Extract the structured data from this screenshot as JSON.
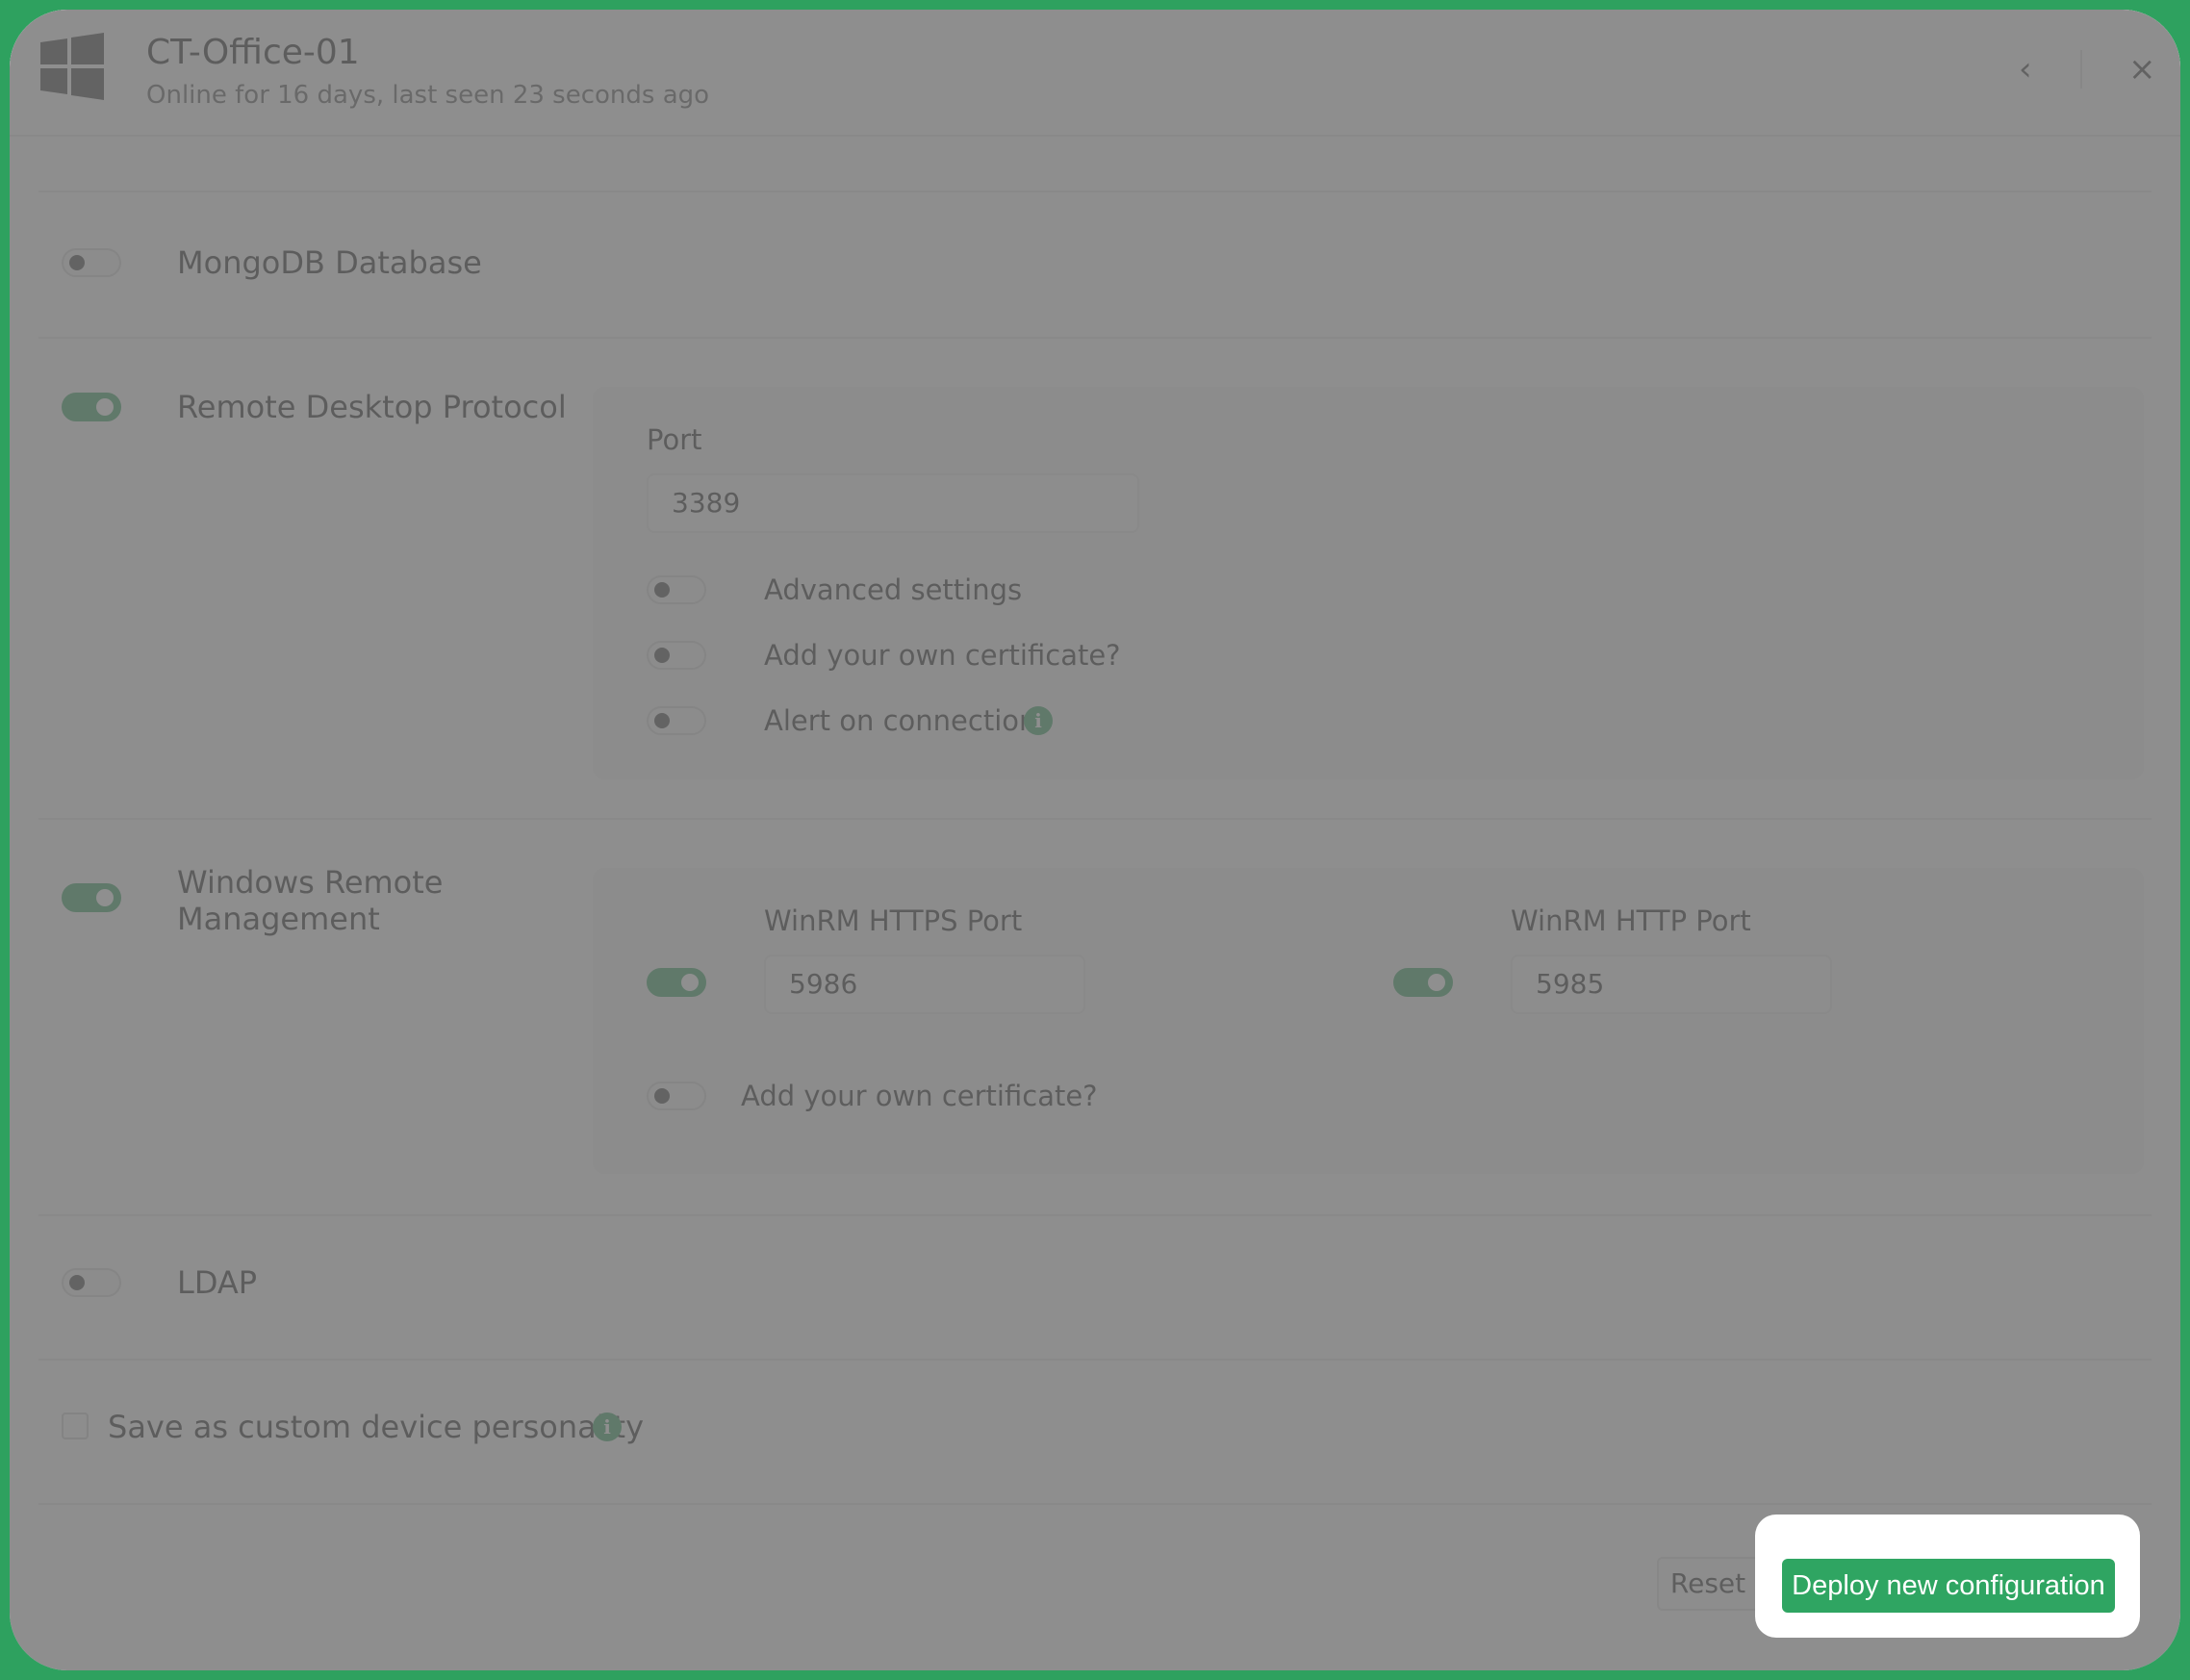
{
  "header": {
    "device_name": "CT-Office-01",
    "status_text": "Online for 16 days, last seen 23 seconds ago",
    "os_icon": "windows-logo-icon",
    "back_icon": "‹",
    "close_icon": "×"
  },
  "services": {
    "mongodb": {
      "label": "MongoDB Database",
      "enabled": false
    },
    "rdp": {
      "label": "Remote Desktop Protocol",
      "enabled": true,
      "port_label": "Port",
      "port_value": "3389",
      "advanced_settings_label": "Advanced settings",
      "advanced_settings_enabled": false,
      "own_certificate_label": "Add your own certificate?",
      "own_certificate_enabled": false,
      "alert_label": "Alert on connection",
      "alert_enabled": false
    },
    "winrm": {
      "label_line1": "Windows Remote",
      "label_line2": "Management",
      "enabled": true,
      "https_port_label": "WinRM HTTPS Port",
      "https_port_value": "5986",
      "https_enabled": true,
      "http_port_label": "WinRM HTTP Port",
      "http_port_value": "5985",
      "http_enabled": true,
      "own_certificate_label": "Add your own certificate?",
      "own_certificate_enabled": false
    },
    "ldap": {
      "label": "LDAP",
      "enabled": false
    }
  },
  "personality": {
    "label": "Save as custom device personality",
    "checked": false
  },
  "actions": {
    "reset_label": "Reset",
    "deploy_label": "Deploy new configuration"
  },
  "colors": {
    "accent": "#2b9a59",
    "frame": "#2ea15f",
    "overlay": "#707070"
  }
}
